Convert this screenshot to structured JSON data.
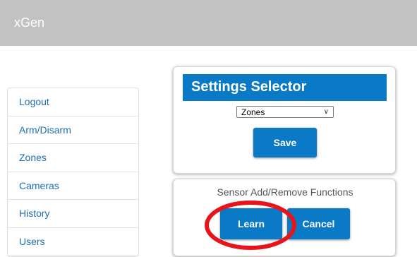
{
  "header": {
    "app_title": "xGen"
  },
  "sidebar": {
    "items": [
      {
        "label": "Logout"
      },
      {
        "label": "Arm/Disarm"
      },
      {
        "label": "Zones"
      },
      {
        "label": "Cameras"
      },
      {
        "label": "History"
      },
      {
        "label": "Users"
      }
    ]
  },
  "settings_selector": {
    "title": "Settings Selector",
    "selected_option": "Zones",
    "save_label": "Save"
  },
  "functions": {
    "label": "Sensor Add/Remove Functions",
    "learn_label": "Learn",
    "cancel_label": "Cancel"
  },
  "colors": {
    "header_bg": "#c2c2c2",
    "accent": "#0a7ac6",
    "link": "#1f6fb2",
    "highlight": "#e8141c"
  }
}
